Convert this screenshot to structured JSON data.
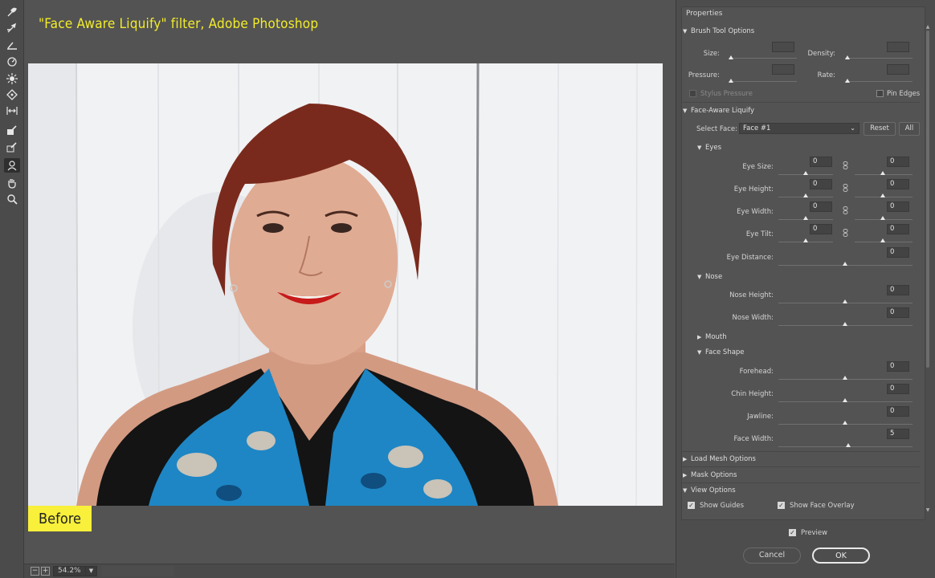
{
  "caption": "\"Face Aware Liquify\" filter, Adobe Photoshop",
  "before_badge": "Before",
  "status": {
    "zoom": "54.2%",
    "zoom_out": "−",
    "zoom_in": "+"
  },
  "panel": {
    "title": "Properties",
    "brush": {
      "title": "Brush Tool Options",
      "size_label": "Size:",
      "density_label": "Density:",
      "pressure_label": "Pressure:",
      "rate_label": "Rate:",
      "stylus_label": "Stylus Pressure",
      "pin_edges_label": "Pin Edges"
    },
    "face": {
      "title": "Face-Aware Liquify",
      "select_face_label": "Select Face:",
      "select_face_value": "Face #1",
      "reset_label": "Reset",
      "all_label": "All",
      "eyes": {
        "title": "Eyes",
        "size_label": "Eye Size:",
        "size_left": "0",
        "size_right": "0",
        "height_label": "Eye Height:",
        "height_left": "0",
        "height_right": "0",
        "width_label": "Eye Width:",
        "width_left": "0",
        "width_right": "0",
        "tilt_label": "Eye Tilt:",
        "tilt_left": "0",
        "tilt_right": "0",
        "distance_label": "Eye Distance:",
        "distance": "0"
      },
      "nose": {
        "title": "Nose",
        "height_label": "Nose Height:",
        "height": "0",
        "width_label": "Nose Width:",
        "width": "0"
      },
      "mouth": {
        "title": "Mouth"
      },
      "face_shape": {
        "title": "Face Shape",
        "forehead_label": "Forehead:",
        "forehead": "0",
        "chin_label": "Chin Height:",
        "chin": "0",
        "jawline_label": "Jawline:",
        "jawline": "0",
        "width_label": "Face Width:",
        "width": "5"
      }
    },
    "load_mesh": "Load Mesh Options",
    "mask": "Mask Options",
    "view": {
      "title": "View Options",
      "show_guides": "Show Guides",
      "show_face_overlay": "Show Face Overlay"
    },
    "preview_label": "Preview",
    "cancel_label": "Cancel",
    "ok_label": "OK"
  }
}
